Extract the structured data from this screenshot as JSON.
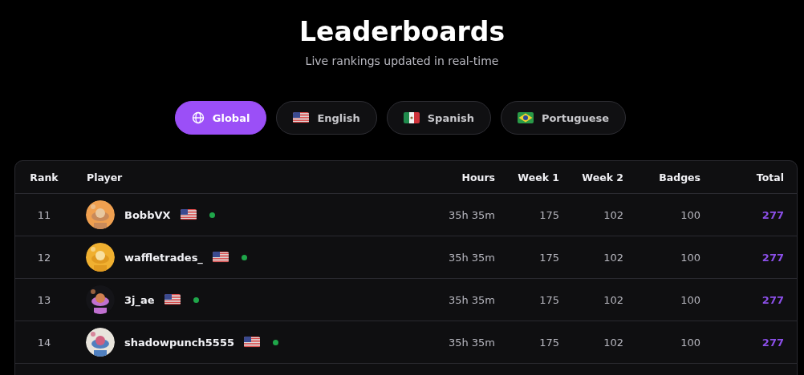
{
  "header": {
    "title": "Leaderboards",
    "subtitle": "Live rankings updated in real-time"
  },
  "tabs": [
    {
      "label": "Global",
      "kind": "globe",
      "selected": true
    },
    {
      "label": "English",
      "kind": "us",
      "selected": false
    },
    {
      "label": "Spanish",
      "kind": "mx",
      "selected": false
    },
    {
      "label": "Portuguese",
      "kind": "br",
      "selected": false
    }
  ],
  "table": {
    "columns": [
      "Rank",
      "Player",
      "Hours",
      "Week 1",
      "Week 2",
      "Badges",
      "Total"
    ],
    "rows": [
      {
        "rank": "11",
        "player": "BobbVX",
        "kind": "us",
        "online": true,
        "hours": "35h 35m",
        "week_1": "175",
        "week_2": "102",
        "badges": "100",
        "total": "277"
      },
      {
        "rank": "12",
        "player": "waffletrades_",
        "kind": "us",
        "online": true,
        "hours": "35h 35m",
        "week_1": "175",
        "week_2": "102",
        "badges": "100",
        "total": "277"
      },
      {
        "rank": "13",
        "player": "3j_ae",
        "kind": "us",
        "online": true,
        "hours": "35h 35m",
        "week_1": "175",
        "week_2": "102",
        "badges": "100",
        "total": "277"
      },
      {
        "rank": "14",
        "player": "shadowpunch5555",
        "kind": "us",
        "online": true,
        "hours": "35h 35m",
        "week_1": "175",
        "week_2": "102",
        "badges": "100",
        "total": "277"
      }
    ]
  }
}
